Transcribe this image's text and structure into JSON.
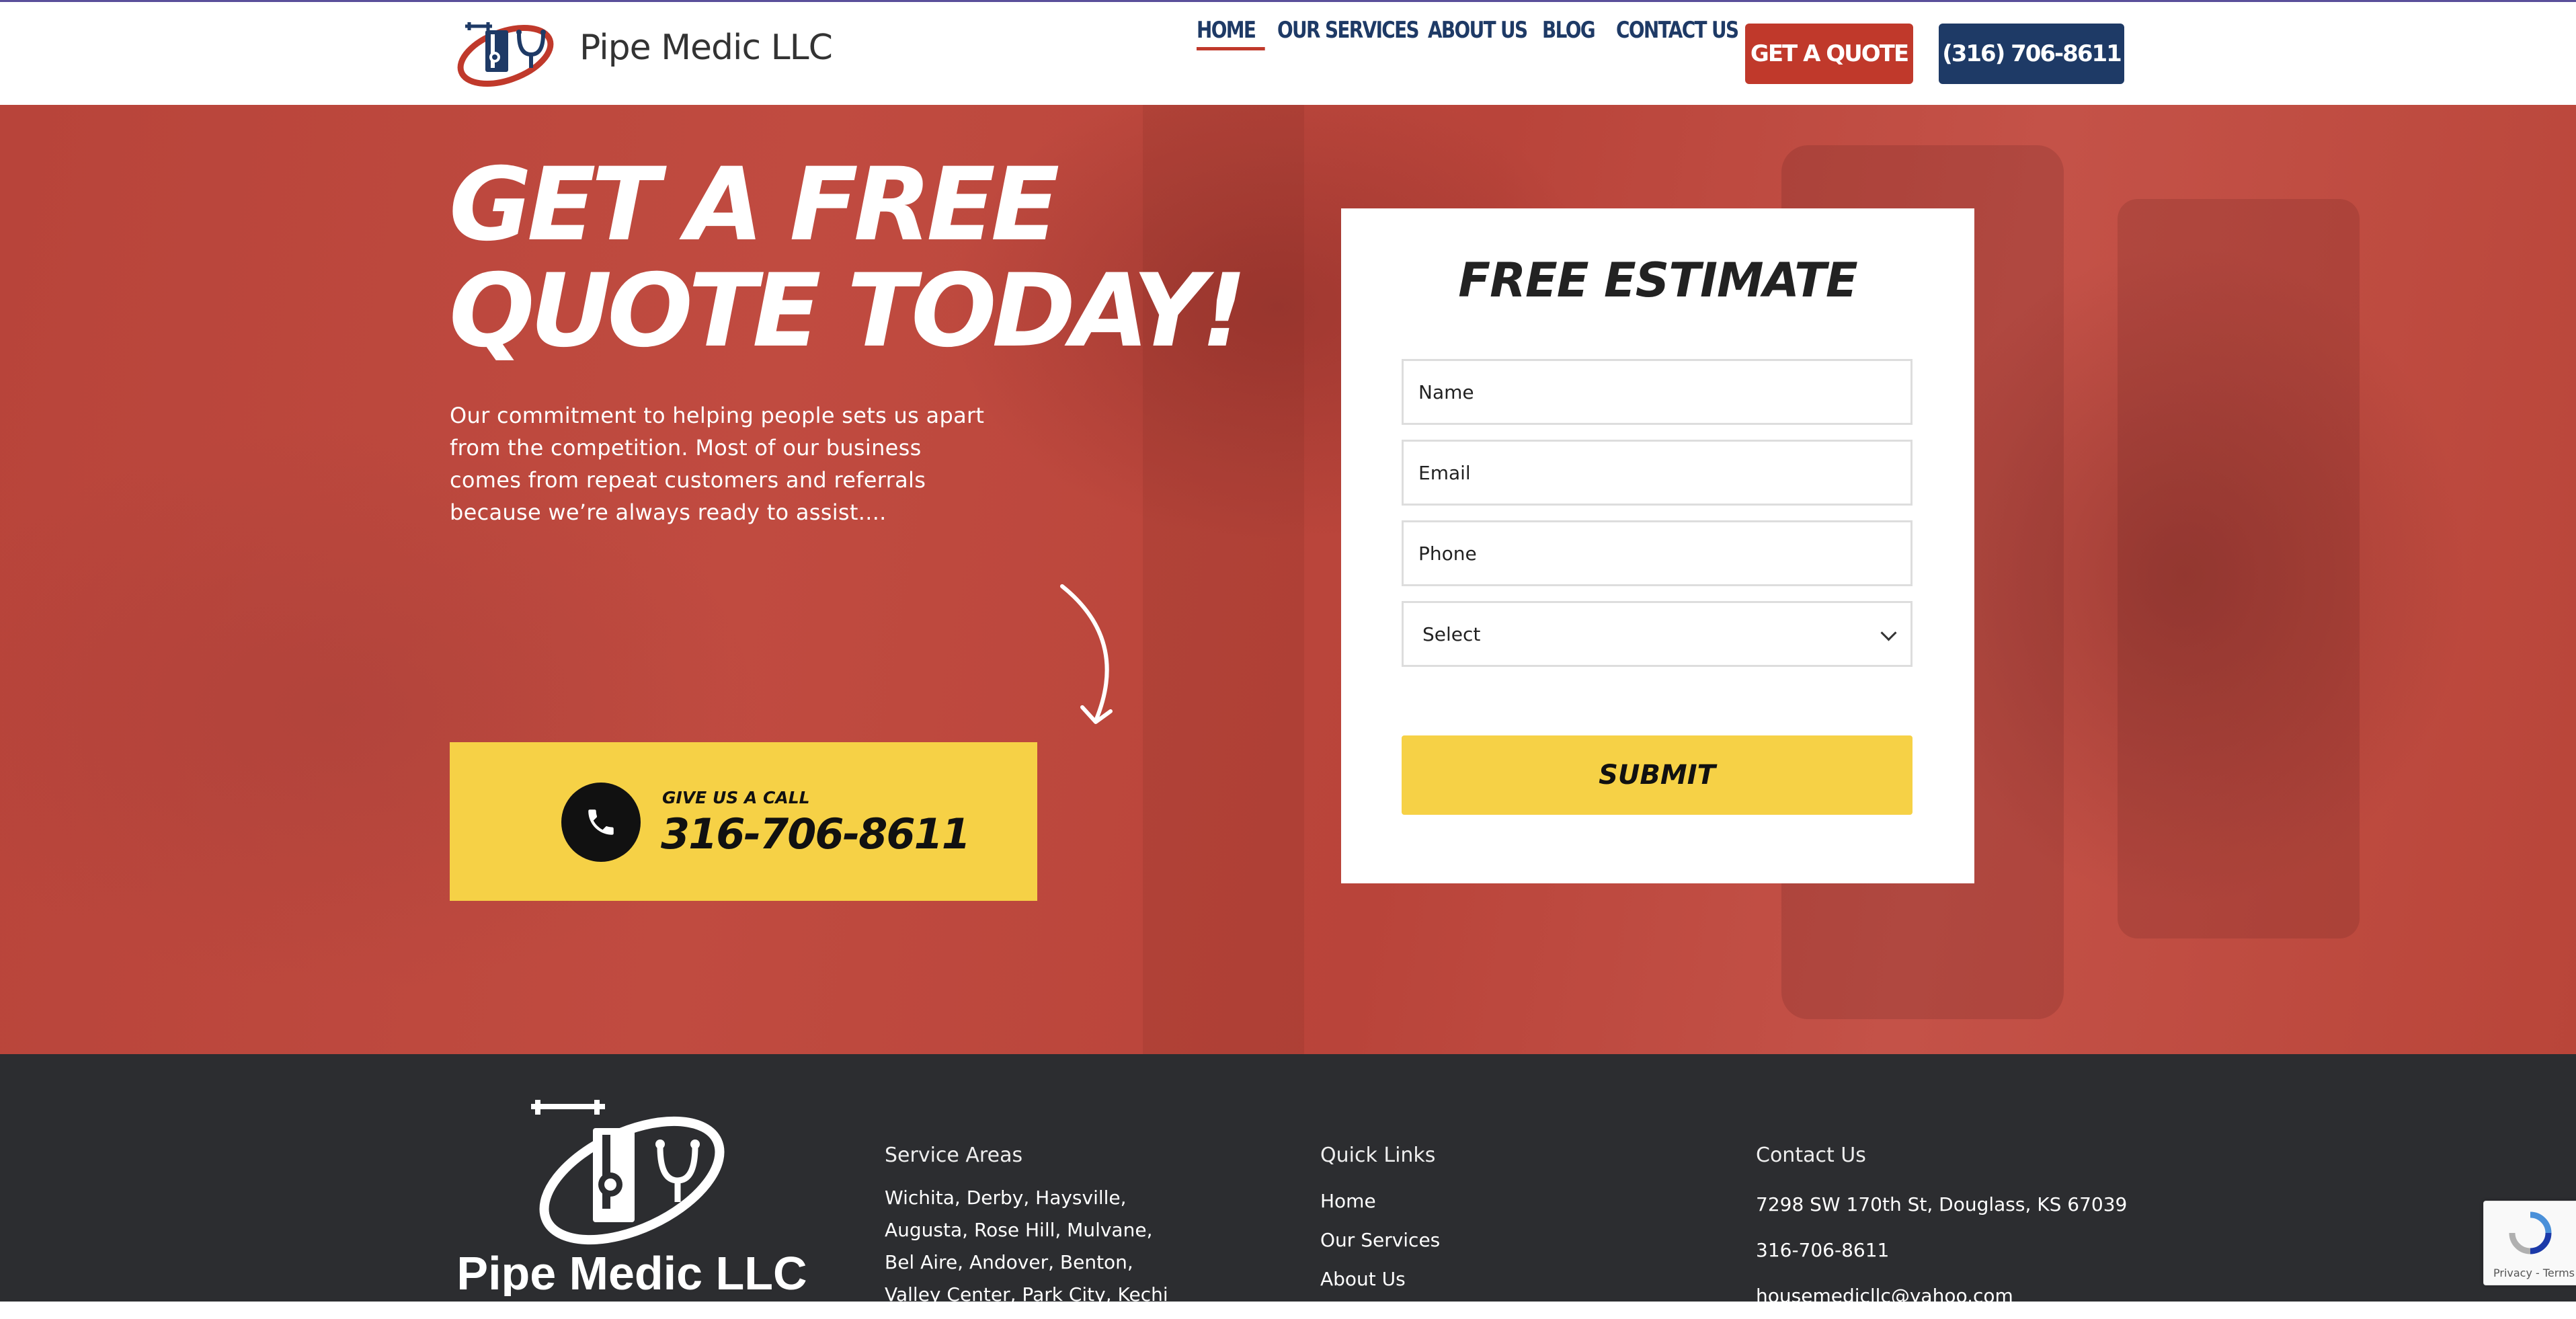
{
  "header": {
    "brand": "Pipe Medic LLC",
    "nav": [
      "HOME",
      "OUR SERVICES",
      "ABOUT US",
      "BLOG",
      "CONTACT US"
    ],
    "active_nav": "HOME",
    "quote_button": "GET A QUOTE",
    "phone_button": "(316) 706-8611"
  },
  "hero": {
    "title_line1": "GET A FREE",
    "title_line2": "QUOTE TODAY!",
    "description": "Our commitment to helping people sets us apart from the competition. Most of our business comes from repeat customers and referrals because we’re always ready to assist....",
    "call_label": "GIVE US A CALL",
    "call_number": "316-706-8611"
  },
  "form": {
    "title": "FREE ESTIMATE",
    "name_placeholder": "Name",
    "email_placeholder": "Email",
    "phone_placeholder": "Phone",
    "select_value": "Select",
    "submit_label": "SUBMIT"
  },
  "footer": {
    "brand": "Pipe Medic LLC",
    "service_areas_title": "Service Areas",
    "service_areas_lines": [
      "Wichita, Derby, Haysville,",
      "Augusta, Rose Hill, Mulvane,",
      "Bel Aire, Andover, Benton,",
      "Valley Center, Park City, Kechi"
    ],
    "quick_links_title": "Quick Links",
    "quick_links": [
      "Home",
      "Our Services",
      "About Us"
    ],
    "contact_title": "Contact Us",
    "address": "7298 SW 170th St, Douglass, KS 67039",
    "phone": "316-706-8611",
    "email": "housemedicllc@yahoo.com"
  },
  "recaptcha": {
    "text": "Privacy - Terms"
  },
  "colors": {
    "brand_red": "#c0392b",
    "navy": "#1e3a66",
    "yellow": "#f6d146",
    "footer_bg": "#2c2d30"
  }
}
